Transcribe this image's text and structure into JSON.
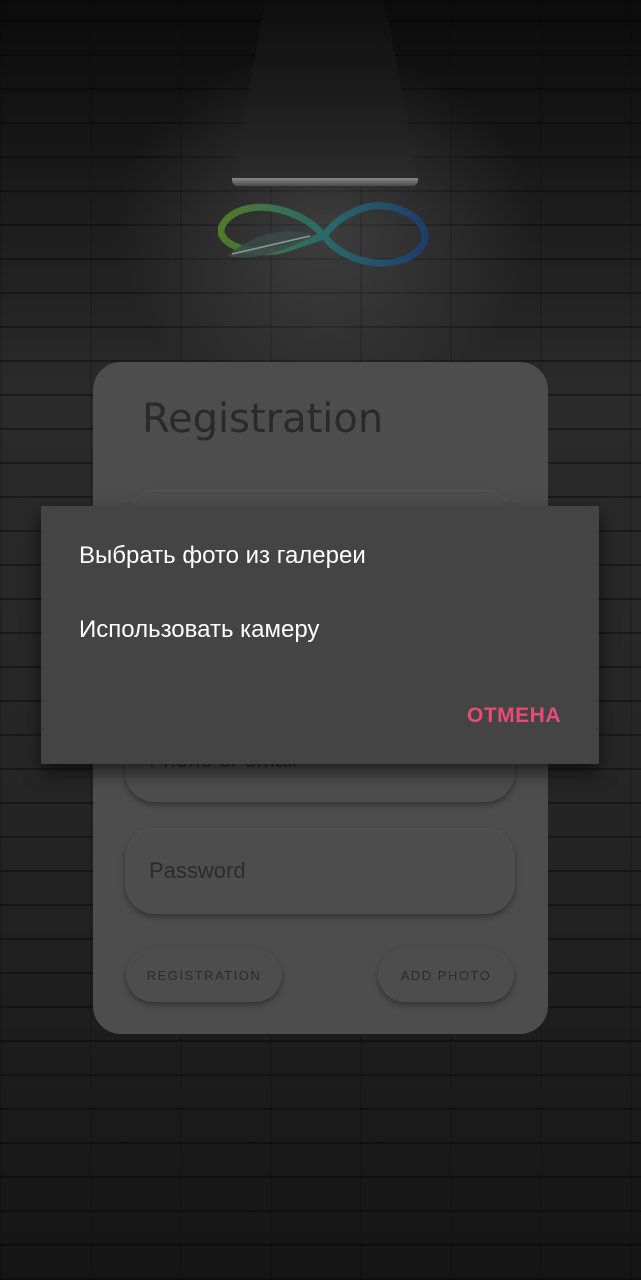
{
  "background": {
    "accent": "#e84a7a",
    "dialog_bg": "#444444",
    "card_bg": "#4d4d4d"
  },
  "logo": {
    "icon": "infinity-feather-logo"
  },
  "registration": {
    "title": "Registration",
    "phone_placeholder": "Phone or email",
    "password_placeholder": "Password",
    "registration_button": "REGISTRATION",
    "add_photo_button": "ADD PHOTO"
  },
  "dialog": {
    "items": [
      "Выбрать фото из галереи",
      "Использовать камеру"
    ],
    "cancel_label": "ОТМЕНА"
  }
}
